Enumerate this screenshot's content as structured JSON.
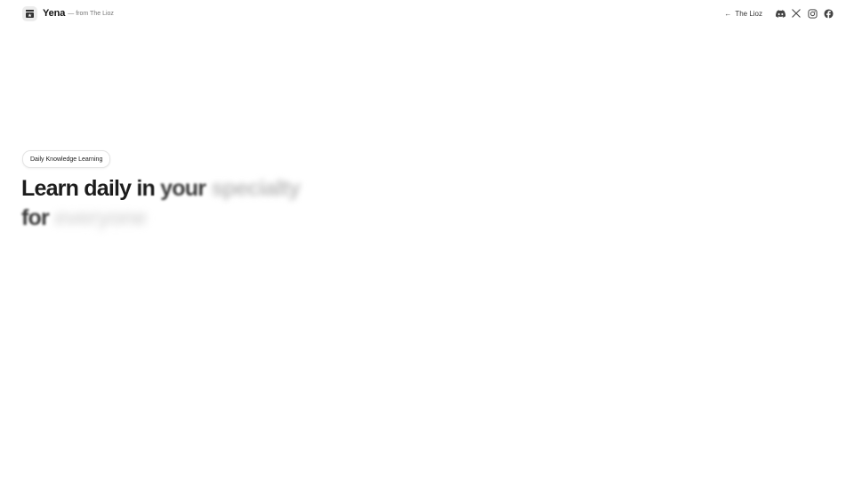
{
  "header": {
    "brand_name": "Yena",
    "brand_from": "— from The Lioz",
    "back_arrow": "←",
    "back_label": "The Lioz",
    "socials": [
      {
        "icon": "discord-icon"
      },
      {
        "icon": "x-icon"
      },
      {
        "icon": "instagram-icon"
      },
      {
        "icon": "facebook-icon"
      }
    ]
  },
  "hero": {
    "badge": "Daily Knowledge Learning",
    "headline_line1": [
      "Learn",
      "daily",
      "in",
      "your",
      "specialty"
    ],
    "headline_line2": [
      "for",
      "everyone"
    ]
  },
  "colors": {
    "text": "#1b1b1b",
    "muted": "#777777",
    "background": "#ffffff",
    "badge_border": "#e4e4e4"
  }
}
